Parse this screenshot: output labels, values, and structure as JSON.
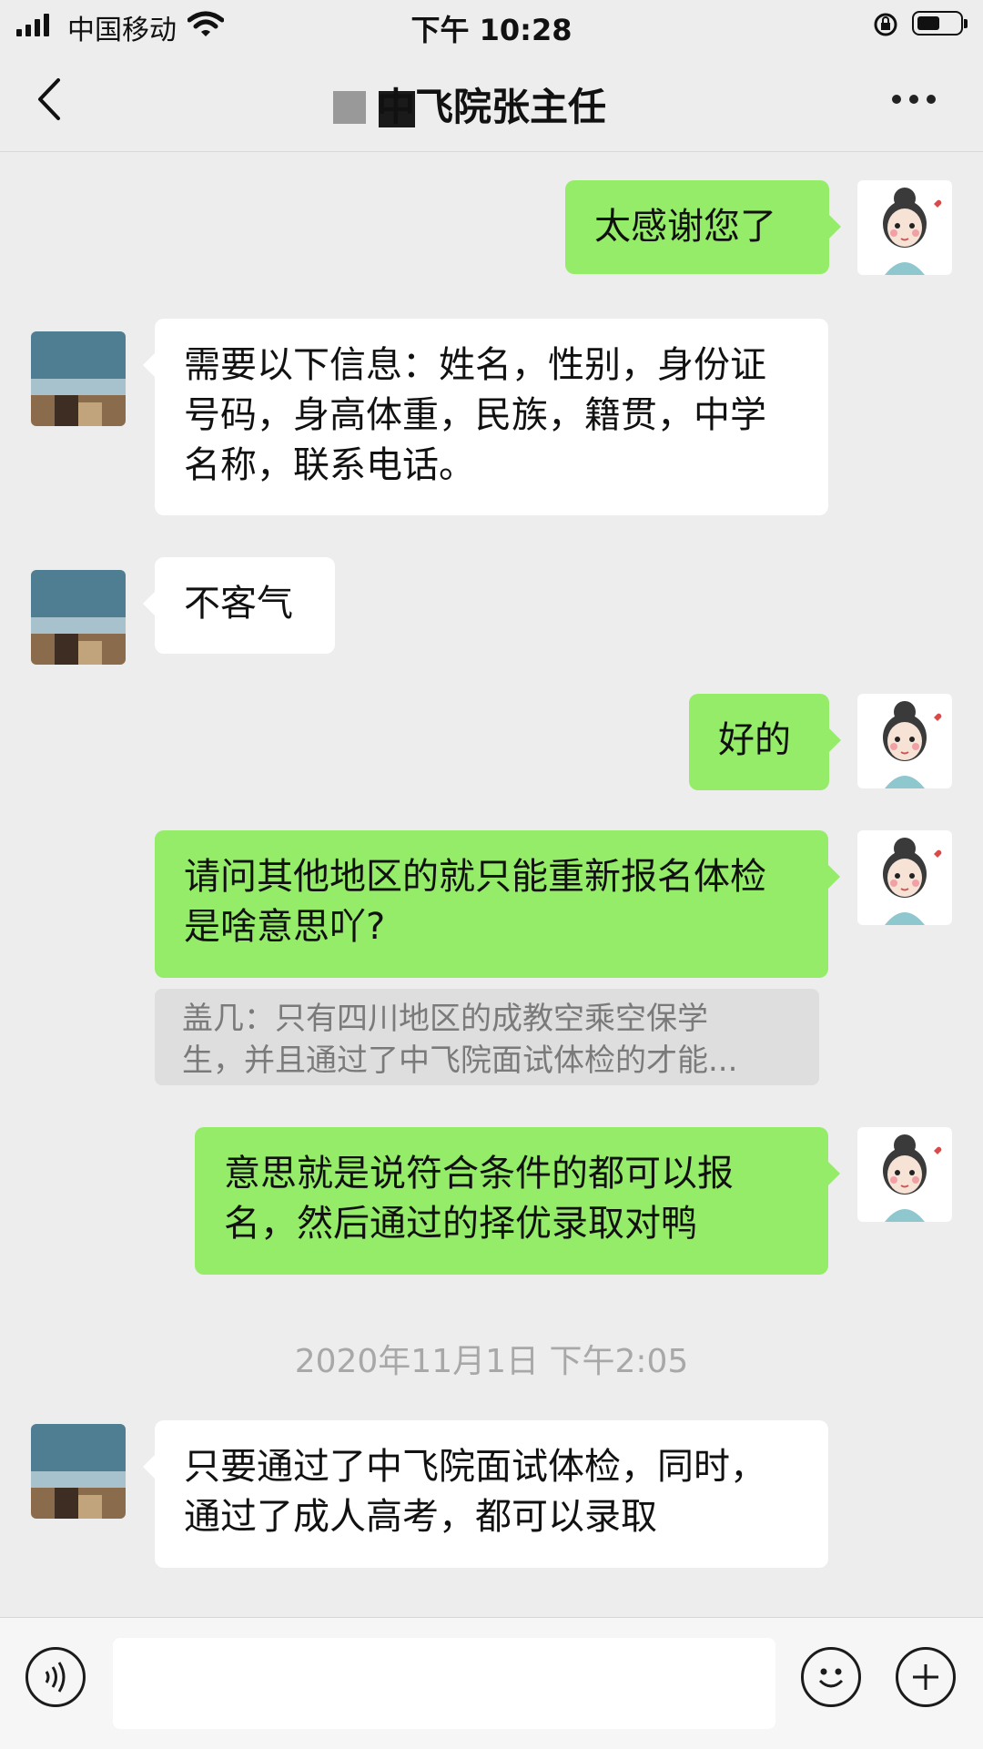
{
  "status_bar": {
    "carrier": "中国移动",
    "time": "下午 10:28"
  },
  "header": {
    "title": "中飞院张主任"
  },
  "messages": [
    {
      "side": "right",
      "text": "太感谢您了"
    },
    {
      "side": "left",
      "text": "需要以下信息：姓名，性别，身份证号码，身高体重，民族，籍贯，中学名称，联系电话。"
    },
    {
      "side": "left",
      "text": "不客气"
    },
    {
      "side": "right",
      "text": "好的"
    },
    {
      "side": "right",
      "text": "请问其他地区的就只能重新报名体检是啥意思吖?"
    },
    {
      "side": "right",
      "text": "意思就是说符合条件的都可以报名，然后通过的择优录取对鸭"
    },
    {
      "side": "left",
      "text": "只要通过了中飞院面试体检，同时，通过了成人高考，都可以录取"
    }
  ],
  "quote": {
    "line1": "盖几：只有四川地区的成教空乘空保学",
    "line2": "生，并且通过了中飞院面试体检的才能..."
  },
  "timestamp": "2020年11月1日 下午2:05",
  "input_bar": {
    "value": "",
    "icons": [
      "voice-icon",
      "emoji-icon",
      "plus-icon"
    ]
  },
  "colors": {
    "background": "#ededed",
    "outgoing_bubble": "#95ec69",
    "incoming_bubble": "#ffffff"
  }
}
